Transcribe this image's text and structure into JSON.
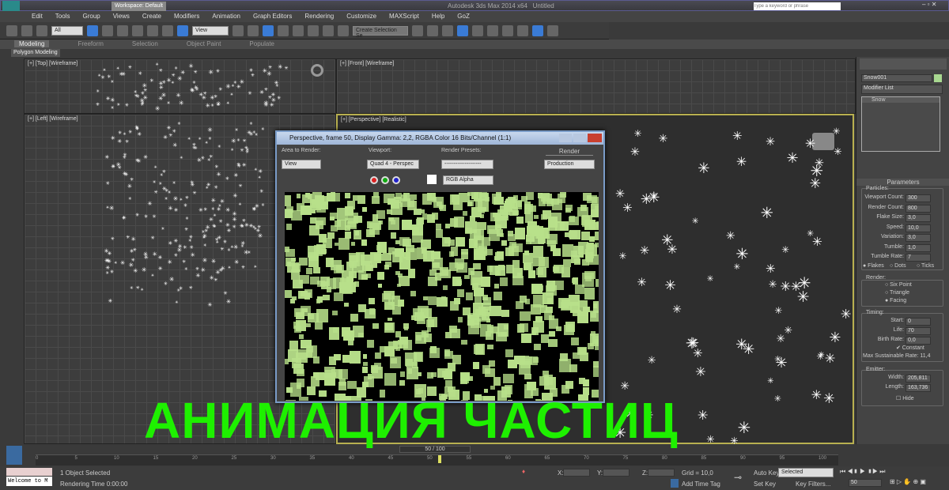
{
  "title": {
    "workspace": "Workspace: Default",
    "app": "Autodesk 3ds Max 2014 x64",
    "doc": "Untitled",
    "search_placeholder": "Type a keyword or phrase"
  },
  "menu": [
    "Edit",
    "Tools",
    "Group",
    "Views",
    "Create",
    "Modifiers",
    "Animation",
    "Graph Editors",
    "Rendering",
    "Customize",
    "MAXScript",
    "Help",
    "GoZ"
  ],
  "toolbar": {
    "filter": "All",
    "coord": "View",
    "selset": "Create Selection Se"
  },
  "ribbon": {
    "tabs": [
      "Modeling",
      "Freeform",
      "Selection",
      "Object Paint",
      "Populate"
    ],
    "sub": "Polygon Modeling"
  },
  "viewports": {
    "top": "[+] [Top] [Wireframe]",
    "front": "[+] [Front] [Wireframe]",
    "left": "[+] [Left] [Wireframe]",
    "persp": "[+] [Perspective] [Realistic]"
  },
  "render": {
    "title": "Perspective, frame 50, Display Gamma: 2,2, RGBA Color 16 Bits/Channel (1:1)",
    "area_label": "Area to Render:",
    "area": "View",
    "viewport_label": "Viewport:",
    "viewport": "Quad 4 - Perspec",
    "preset_label": "Render Presets:",
    "preset": "--------------------",
    "render_btn": "Render",
    "mode": "Production",
    "channel": "RGB Alpha"
  },
  "cmd": {
    "name": "Snow001",
    "modlist": "Modifier List",
    "stack": "Snow",
    "params": "Parameters",
    "particles": "Particles:",
    "vcount_l": "Viewport Count:",
    "vcount": "300",
    "rcount_l": "Render Count:",
    "rcount": "800",
    "flake_l": "Flake Size:",
    "flake": "3,0",
    "speed_l": "Speed:",
    "speed": "10,0",
    "var_l": "Variation:",
    "var": "3,0",
    "tumble_l": "Tumble:",
    "tumble": "1,0",
    "trate_l": "Tumble Rate:",
    "trate": "7",
    "opts": [
      "Flakes",
      "Dots",
      "Ticks"
    ],
    "render": "Render:",
    "rend_opts": [
      "Six Point",
      "Triangle",
      "Facing"
    ],
    "timing": "Timing:",
    "start_l": "Start:",
    "start": "0",
    "life_l": "Life:",
    "life": "70",
    "birth_l": "Birth Rate:",
    "birth": "0,0",
    "constant": "Constant",
    "maxrate": "Max Sustainable Rate: 11,4",
    "emitter": "Emitter:",
    "width_l": "Width:",
    "width": "205,811",
    "length_l": "Length:",
    "length": "163,736",
    "hide": "Hide"
  },
  "time": {
    "slider": "50 / 100",
    "ticks": [
      "0",
      "5",
      "10",
      "15",
      "20",
      "25",
      "30",
      "35",
      "40",
      "45",
      "50",
      "55",
      "60",
      "65",
      "70",
      "75",
      "80",
      "85",
      "90",
      "95",
      "100"
    ]
  },
  "status": {
    "welcome": "Welcome to M",
    "selected": "1 Object Selected",
    "rtime": "Rendering Time  0:00:00",
    "x": "X:",
    "y": "Y:",
    "z": "Z:",
    "grid": "Grid = 10,0",
    "addtag": "Add Time Tag",
    "autokey": "Auto Key",
    "setkey": "Set Key",
    "keymode": "Selected",
    "keyfilters": "Key Filters...",
    "frame": "50"
  },
  "overlay": "АНИМАЦИЯ ЧАСТИЦ"
}
